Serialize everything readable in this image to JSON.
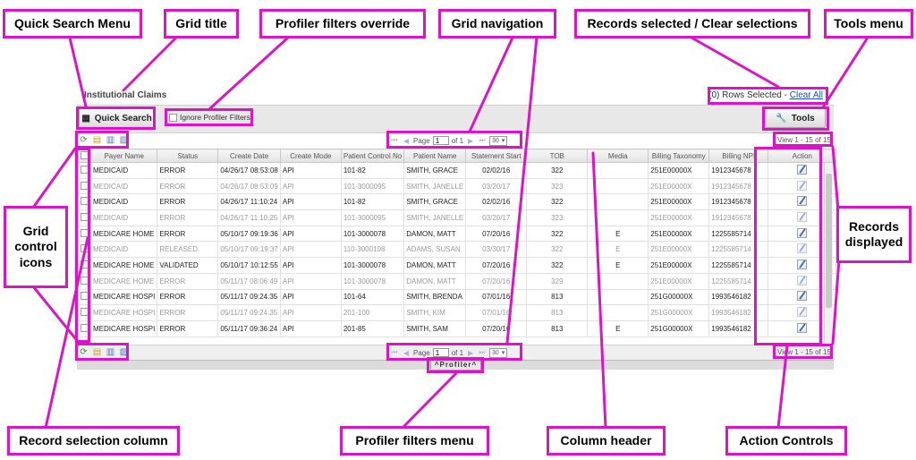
{
  "labels": {
    "quick_search_menu": "Quick Search Menu",
    "grid_title": "Grid title",
    "profiler_override": "Profiler filters override",
    "grid_navigation": "Grid navigation",
    "records_selected": "Records selected / Clear selections",
    "tools_menu": "Tools menu",
    "grid_control_icons": "Grid control icons",
    "records_displayed": "Records displayed",
    "record_selection_column": "Record selection column",
    "profiler_menu": "Profiler filters menu",
    "column_header": "Column header",
    "action_controls": "Action Controls"
  },
  "app": {
    "title": "Institutional Claims",
    "rows_selected": "(0) Rows Selected - ",
    "clear_all": "Clear All",
    "quick_search": "Quick Search",
    "ignore_filters": "Ignore Profiler Filters",
    "tools": "Tools",
    "pager": {
      "page_label": "Page",
      "page_value": "1",
      "of_label": "of 1",
      "per_page": "30"
    },
    "view_text": "View 1 - 15 of 15",
    "profiler": "^Profiler^"
  },
  "grid": {
    "columns": [
      "Payer Name",
      "Status",
      "Create Date",
      "Create Mode",
      "Patient Control No",
      "Patient Name",
      "Statement Start",
      "TOB",
      "Media",
      "Billing Taxonomy",
      "Billing NPI",
      "Action"
    ],
    "rows": [
      {
        "payer": "MEDICAID",
        "status": "ERROR",
        "date": "04/26/17 08:53:08",
        "mode": "API",
        "pcn": "101-82",
        "patient": "SMITH, GRACE",
        "start": "02/02/16",
        "tob": "322",
        "media": "",
        "tax": "251E00000X",
        "npi": "1912345678",
        "dim": false
      },
      {
        "payer": "MEDICAID",
        "status": "ERROR",
        "date": "04/26/17 08:53:09",
        "mode": "API",
        "pcn": "101-3000095",
        "patient": "SMITH, JANELLE",
        "start": "03/20/17",
        "tob": "323",
        "media": "",
        "tax": "251E00000X",
        "npi": "1912345678",
        "dim": true
      },
      {
        "payer": "MEDICAID",
        "status": "ERROR",
        "date": "04/26/17 11:10:24",
        "mode": "API",
        "pcn": "101-82",
        "patient": "SMITH, GRACE",
        "start": "02/02/16",
        "tob": "322",
        "media": "",
        "tax": "251E00000X",
        "npi": "1912345678",
        "dim": false
      },
      {
        "payer": "MEDICAID",
        "status": "ERROR",
        "date": "04/26/17 11:10:25",
        "mode": "API",
        "pcn": "101-3000095",
        "patient": "SMITH, JANELLE",
        "start": "03/20/17",
        "tob": "323",
        "media": "",
        "tax": "251E00000X",
        "npi": "1912345678",
        "dim": true
      },
      {
        "payer": "MEDICARE HOME",
        "status": "ERROR",
        "date": "05/10/17 09:19:36",
        "mode": "API",
        "pcn": "101-3000078",
        "patient": "DAMON, MATT",
        "start": "07/20/16",
        "tob": "322",
        "media": "E",
        "tax": "251E00000X",
        "npi": "1225585714",
        "dim": false
      },
      {
        "payer": "MEDICAID",
        "status": "RELEASED",
        "date": "05/10/17 09:19:37",
        "mode": "API",
        "pcn": "110-3000108",
        "patient": "ADAMS, SUSAN",
        "start": "03/30/17",
        "tob": "322",
        "media": "E",
        "tax": "251E00000X",
        "npi": "1225585714",
        "dim": true
      },
      {
        "payer": "MEDICARE HOME",
        "status": "VALIDATED",
        "date": "05/10/17 10:12:55",
        "mode": "API",
        "pcn": "101-3000078",
        "patient": "DAMON, MATT",
        "start": "07/20/16",
        "tob": "322",
        "media": "E",
        "tax": "251E00000X",
        "npi": "1225585714",
        "dim": false
      },
      {
        "payer": "MEDICARE HOME",
        "status": "ERROR",
        "date": "05/11/17 08:06:49",
        "mode": "API",
        "pcn": "101-3000078",
        "patient": "DAMON, MATT",
        "start": "07/20/16",
        "tob": "329",
        "media": "",
        "tax": "251E00000X",
        "npi": "1225585714",
        "dim": true
      },
      {
        "payer": "MEDICARE HOSPI",
        "status": "ERROR",
        "date": "05/11/17 09:24:35",
        "mode": "API",
        "pcn": "101-64",
        "patient": "SMITH, BRENDA",
        "start": "07/01/16",
        "tob": "813",
        "media": "",
        "tax": "251G00000X",
        "npi": "1993546182",
        "dim": false
      },
      {
        "payer": "MEDICARE HOSPI",
        "status": "ERROR",
        "date": "05/11/17 09:24:35",
        "mode": "API",
        "pcn": "201-100",
        "patient": "SMITH, KIM",
        "start": "07/01/16",
        "tob": "813",
        "media": "",
        "tax": "251G00000X",
        "npi": "1993546182",
        "dim": true
      },
      {
        "payer": "MEDICARE HOSPI",
        "status": "ERROR",
        "date": "05/11/17 09:36:24",
        "mode": "API",
        "pcn": "201-85",
        "patient": "SMITH, SAM",
        "start": "07/20/16",
        "tob": "813",
        "media": "E",
        "tax": "251G00000X",
        "npi": "1993546182",
        "dim": false
      }
    ]
  }
}
